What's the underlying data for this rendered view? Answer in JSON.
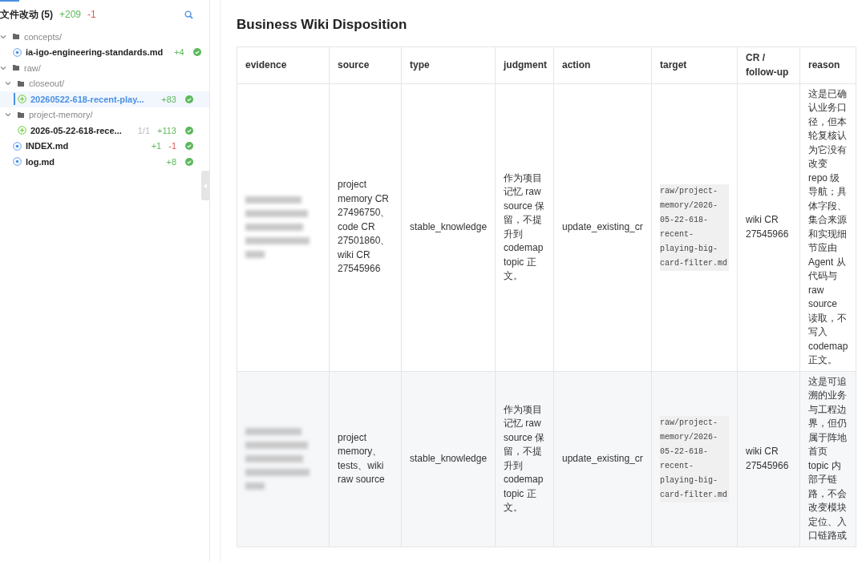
{
  "sidebar": {
    "title": "文件改动 (5)",
    "additions": "+209",
    "deletions": "-1",
    "tree": [
      {
        "kind": "folder",
        "name": "concepts/",
        "expanded": true,
        "children": [
          {
            "kind": "modified",
            "name": "ia-igo-engineering-standards.md",
            "selected": false,
            "added": "+4",
            "done": true
          }
        ]
      },
      {
        "kind": "folder",
        "name": "raw/",
        "expanded": true,
        "children": [
          {
            "kind": "folder",
            "name": "closeout/",
            "expanded": true,
            "children": [
              {
                "kind": "added",
                "name": "20260522-618-recent-play...",
                "selected": true,
                "added": "+83",
                "done": true
              }
            ]
          },
          {
            "kind": "folder",
            "name": "project-memory/",
            "expanded": true,
            "children": [
              {
                "kind": "added",
                "name": "2026-05-22-618-rece...",
                "selected": false,
                "count": "1/1",
                "added": "+113",
                "done": true
              }
            ]
          },
          {
            "kind": "modified",
            "name": "INDEX.md",
            "selected": false,
            "added": "+1",
            "removed": "-1",
            "done": true
          },
          {
            "kind": "modified",
            "name": "log.md",
            "selected": false,
            "added": "+8",
            "done": true
          }
        ]
      }
    ]
  },
  "document": {
    "title": "Business Wiki Disposition",
    "table": {
      "columns": [
        "evidence",
        "source",
        "type",
        "judgment",
        "action",
        "target",
        "CR / follow-up",
        "reason"
      ],
      "rows": [
        {
          "evidence": {
            "blurred": true
          },
          "source": "project memory CR 27496750、code CR 27501860、wiki CR 27545966",
          "type": "stable_knowledge",
          "judgment": "作为项目记忆 raw source 保留，不提升到 codemap topic 正文。",
          "action": "update_existing_cr",
          "target": "raw/project-memory/2026-05-22-618-recent-playing-big-card-filter.md",
          "cr": "wiki CR 27545966",
          "reason": "这是已确认业务口径，但本轮复核认为它没有改变 repo 级导航；具体字段、集合来源和实现细节应由 Agent 从代码与 raw source 读取，不写入 codemap 正文。"
        },
        {
          "evidence": {
            "blurred": true
          },
          "source": "project memory、tests、wiki raw source",
          "type": "stable_knowledge",
          "judgment": "作为项目记忆 raw source 保留，不提升到 codemap topic 正文。",
          "action": "update_existing_cr",
          "target": "raw/project-memory/2026-05-22-618-recent-playing-big-card-filter.md",
          "cr": "wiki CR 27545966",
          "reason": "这是可追溯的业务与工程边界，但仍属于阵地首页 topic 内部子链路，不会改变模块定位、入口链路或"
        }
      ]
    }
  }
}
